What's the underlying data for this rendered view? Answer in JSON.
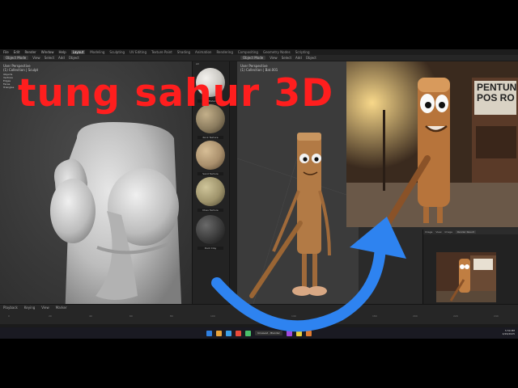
{
  "overlay": {
    "title": "tung sahur 3D",
    "title_color": "#ff1e1e",
    "arrow_color": "#2e83f0"
  },
  "menubar": {
    "items": [
      "File",
      "Edit",
      "Render",
      "Window",
      "Help"
    ],
    "workspaces": [
      "Layout",
      "Modeling",
      "Sculpting",
      "UV Editing",
      "Texture Paint",
      "Shading",
      "Animation",
      "Rendering",
      "Compositing",
      "Geometry Nodes",
      "Scripting"
    ],
    "active_workspace": "Layout"
  },
  "left_header": {
    "mode": "Object Mode",
    "menus": [
      "View",
      "Select",
      "Add",
      "Object"
    ]
  },
  "left_viewport": {
    "overlay_lines": [
      "User Perspective",
      "(1) Collection | Sculpt",
      "Objects",
      "Vertices",
      "Edges",
      "Faces",
      "Triangles"
    ]
  },
  "right_header": {
    "mode": "Object Mode",
    "menus": [
      "View",
      "Select",
      "Add",
      "Object"
    ]
  },
  "right_viewport": {
    "overlay_lines": [
      "User Perspective",
      "(1) Collection | Bat.001"
    ]
  },
  "assets": {
    "header": "All",
    "items": [
      {
        "label": "Clay Material",
        "color": "#c9c7c2"
      },
      {
        "label": "Rock Texture",
        "color": "#8a7b5e"
      },
      {
        "label": "Sand Texture",
        "color": "#a98f6c"
      },
      {
        "label": "Moss Texture",
        "color": "#9e936b"
      },
      {
        "label": "Dark Clay",
        "color": "#3b3b3b"
      }
    ]
  },
  "render_panel": {
    "tabs": [
      "Image",
      "View",
      "Image"
    ],
    "slot": "Render Result"
  },
  "reference_image": {
    "sign_text": "PENTUN POS RO"
  },
  "timeline": {
    "menus": [
      "Playback",
      "Keying",
      "View",
      "Marker"
    ],
    "ticks": [
      "0",
      "20",
      "40",
      "60",
      "80",
      "100",
      "120",
      "140",
      "160",
      "180",
      "200",
      "220",
      "240"
    ]
  },
  "taskbar": {
    "task_label": "Unsaved - Blender",
    "time": "5:59 PM",
    "date": "4/26/2025",
    "icon_colors": [
      "#2f7fe0",
      "#e9a43a",
      "#3aa0e9",
      "#e94a3a",
      "#4ac06a",
      "#a04ae0",
      "#e9d23a",
      "#e07a2f"
    ]
  }
}
